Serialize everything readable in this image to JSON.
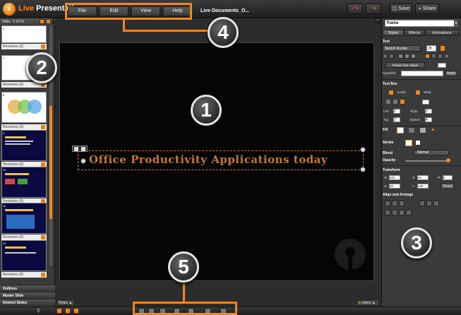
{
  "header": {
    "logo_letter": "i",
    "app_title_prefix": "Live",
    "app_title_suffix": " Presentations",
    "menu": [
      "File",
      "Edit",
      "View",
      "Help"
    ],
    "doc_title": "Live Documents_O...",
    "save_label": "Save",
    "share_label": "Share"
  },
  "left_panel": {
    "slide_counter": "Slide - 1 of 16",
    "revisions_label": "Revisions (0)",
    "thumbnails": [
      "1",
      "7",
      "8",
      "9",
      "10",
      "11",
      "12"
    ],
    "sections": [
      "Outlines",
      "Master Slide",
      "Deleted Slides"
    ]
  },
  "canvas": {
    "slide_text": "Office Productivity Applications today"
  },
  "right_panel": {
    "object_name": "frame",
    "tabs": [
      "Styles",
      "Effects",
      "Animations"
    ],
    "text_heading": "Text",
    "font_name": "Sketch Rockw",
    "font_size": "28",
    "preset_label": "Preset Text Styles",
    "hyperlink_label": "Hyperlink",
    "apply_label": "Apply",
    "text_box_heading": "Text Box",
    "autofit_label": "Autofit",
    "wrap_label": "Wrap",
    "left_label": "Left",
    "right_label": "Right",
    "top_label": "Top",
    "bottom_label": "Bottom",
    "margin_left": "2",
    "margin_right": "2",
    "margin_top": "2",
    "margin_bottom": "4",
    "fill_label": "Fill",
    "stroke_label": "Stroke",
    "blend_label": "Blend",
    "blend_value": "Normal",
    "opacity_label": "Opacity",
    "transform_heading": "Transform",
    "w_label": "W:",
    "h_label": "H:",
    "x_label": "X:",
    "y_label": "Y:",
    "r_label": "R:",
    "w_value": "404",
    "h_value": "36",
    "x_value": "42",
    "y_value": "246",
    "r_value": "0",
    "reset_label": "Reset",
    "align_heading": "Align and Arrange"
  },
  "bottom": {
    "notes_label": "Notes",
    "users_label": "Users"
  },
  "callouts": [
    "1",
    "2",
    "3",
    "4",
    "5"
  ],
  "colors": {
    "accent": "#f0871a",
    "slide_text": "#c17a34",
    "canvas_bg": "#050505"
  }
}
